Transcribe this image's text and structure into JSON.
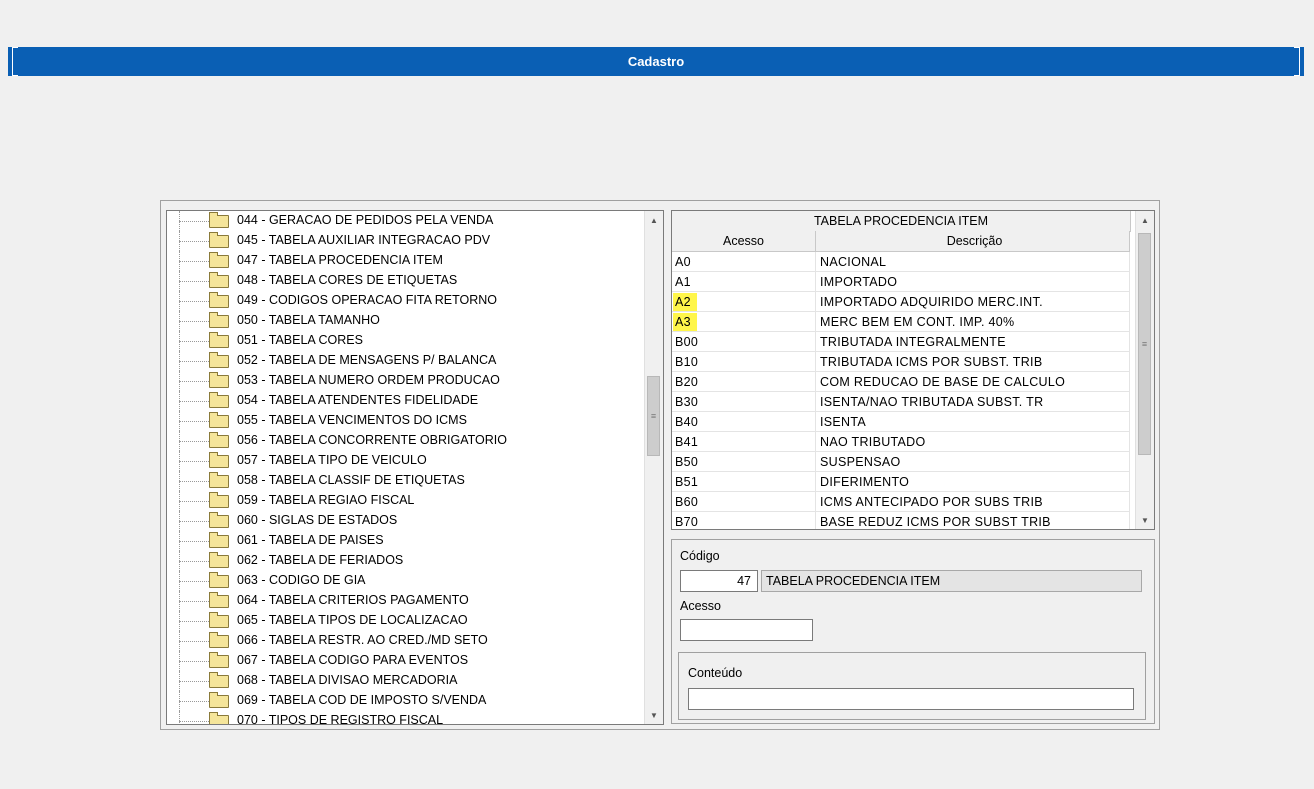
{
  "window": {
    "title": "Cadastro"
  },
  "tree": {
    "items": [
      "044 - GERACAO DE PEDIDOS PELA VENDA",
      "045 - TABELA AUXILIAR INTEGRACAO PDV",
      "047 - TABELA PROCEDENCIA ITEM",
      "048 - TABELA CORES DE ETIQUETAS",
      "049 - CODIGOS OPERACAO FITA RETORNO",
      "050 - TABELA TAMANHO",
      "051 - TABELA CORES",
      "052 - TABELA DE MENSAGENS P/ BALANCA",
      "053 - TABELA NUMERO ORDEM  PRODUCAO",
      "054 - TABELA ATENDENTES FIDELIDADE",
      "055 - TABELA VENCIMENTOS DO ICMS",
      "056 - TABELA CONCORRENTE OBRIGATORIO",
      "057 - TABELA TIPO DE VEICULO",
      "058 - TABELA CLASSIF DE ETIQUETAS",
      "059 - TABELA REGIAO FISCAL",
      "060 - SIGLAS DE ESTADOS",
      "061 - TABELA DE PAISES",
      "062 - TABELA DE FERIADOS",
      "063 - CODIGO DE GIA",
      "064 - TABELA CRITERIOS PAGAMENTO",
      "065 - TABELA TIPOS DE LOCALIZACAO",
      "066 - TABELA RESTR. AO CRED./MD SETO",
      "067 - TABELA CODIGO PARA EVENTOS",
      "068 - TABELA DIVISAO MERCADORIA",
      "069 - TABELA COD DE IMPOSTO S/VENDA",
      "070 - TIPOS DE REGISTRO FISCAL"
    ]
  },
  "grid": {
    "title": "TABELA PROCEDENCIA ITEM",
    "columns": [
      "Acesso",
      "Descrição"
    ],
    "highlight_color": "#fff64a",
    "rows": [
      {
        "acesso": "A0",
        "descricao": "NACIONAL",
        "highlight": false
      },
      {
        "acesso": "A1",
        "descricao": "IMPORTADO",
        "highlight": false
      },
      {
        "acesso": "A2",
        "descricao": "IMPORTADO ADQUIRIDO MERC.INT.",
        "highlight": true
      },
      {
        "acesso": "A3",
        "descricao": "MERC BEM EM CONT. IMP.  40%",
        "highlight": true
      },
      {
        "acesso": "B00",
        "descricao": "TRIBUTADA INTEGRALMENTE",
        "highlight": false
      },
      {
        "acesso": "B10",
        "descricao": "TRIBUTADA ICMS POR SUBST. TRIB",
        "highlight": false
      },
      {
        "acesso": "B20",
        "descricao": "COM REDUCAO DE BASE DE CALCULO",
        "highlight": false
      },
      {
        "acesso": "B30",
        "descricao": "ISENTA/NAO TRIBUTADA SUBST. TR",
        "highlight": false
      },
      {
        "acesso": "B40",
        "descricao": "ISENTA",
        "highlight": false
      },
      {
        "acesso": "B41",
        "descricao": "NAO TRIBUTADO",
        "highlight": false
      },
      {
        "acesso": "B50",
        "descricao": "SUSPENSAO",
        "highlight": false
      },
      {
        "acesso": "B51",
        "descricao": "DIFERIMENTO",
        "highlight": false
      },
      {
        "acesso": "B60",
        "descricao": "ICMS ANTECIPADO POR SUBS TRIB",
        "highlight": false
      },
      {
        "acesso": "B70",
        "descricao": "BASE REDUZ ICMS POR SUBST TRIB",
        "highlight": false
      }
    ]
  },
  "form": {
    "codigo_label": "Código",
    "codigo_value": "47",
    "codigo_desc": "TABELA PROCEDENCIA ITEM",
    "acesso_label": "Acesso",
    "acesso_value": "",
    "conteudo_label": "Conteúdo",
    "conteudo_value": ""
  }
}
